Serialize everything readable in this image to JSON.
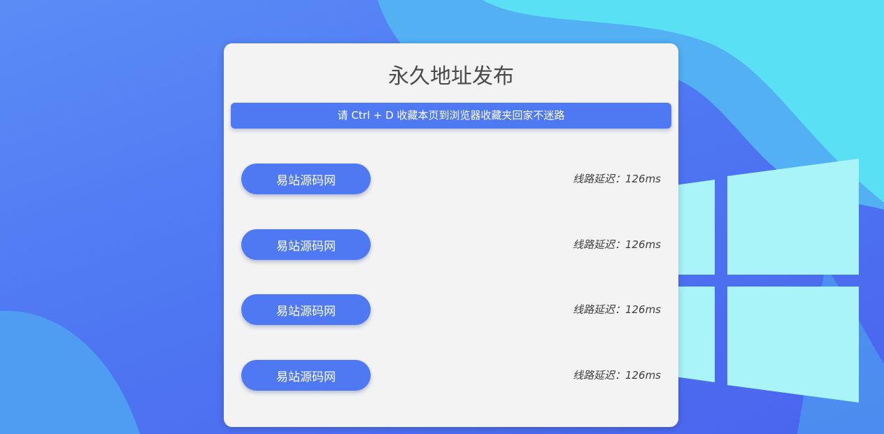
{
  "page": {
    "title": "永久地址发布",
    "notice": "请 Ctrl + D 收藏本页到浏览器收藏夹回家不迷路"
  },
  "lines": [
    {
      "label": "易站源码网",
      "latency": "线路延迟：126ms"
    },
    {
      "label": "易站源码网",
      "latency": "线路延迟：126ms"
    },
    {
      "label": "易站源码网",
      "latency": "线路延迟：126ms"
    },
    {
      "label": "易站源码网",
      "latency": "线路延迟：126ms"
    }
  ],
  "colors": {
    "accent": "#4f78f3",
    "card": "#f3f3f3",
    "text": "#4a4a4a",
    "windows_logo": "#a8f4f8"
  },
  "icons": {
    "background_logo": "windows-logo-icon"
  }
}
